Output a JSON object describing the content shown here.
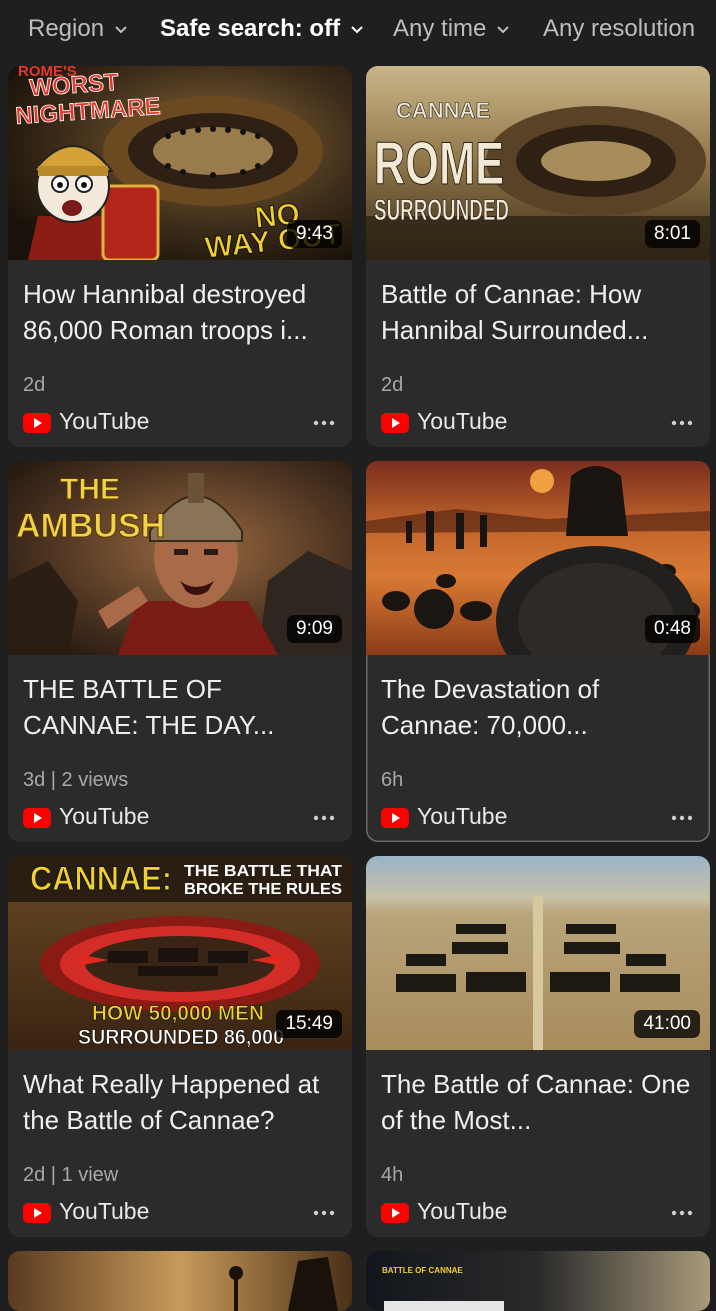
{
  "filters": [
    {
      "label": "Region",
      "active": false
    },
    {
      "label": "Safe search: off",
      "active": true
    },
    {
      "label": "Any time",
      "active": false
    },
    {
      "label": "Any resolution",
      "active": false
    }
  ],
  "results": [
    {
      "thumb_text": [
        "ROME'S",
        "WORST",
        "NIGHTMARE",
        "NO",
        "WAY OUT"
      ],
      "duration": "9:43",
      "title": "How Hannibal destroyed 86,000 Roman troops i...",
      "meta": "2d",
      "source": "YouTube"
    },
    {
      "thumb_text": [
        "CANNAE",
        "ROME",
        "SURROUNDED"
      ],
      "duration": "8:01",
      "title": "Battle of Cannae: How Hannibal Surrounded...",
      "meta": "2d",
      "source": "YouTube"
    },
    {
      "thumb_text": [
        "THE",
        "AMBUSH"
      ],
      "duration": "9:09",
      "title": "THE BATTLE OF CANNAE: THE DAY...",
      "meta": "3d | 2 views",
      "source": "YouTube"
    },
    {
      "thumb_text": [],
      "duration": "0:48",
      "title": "The Devastation of Cannae: 70,000...",
      "meta": "6h",
      "source": "YouTube"
    },
    {
      "thumb_text": [
        "CANNAE:",
        "THE BATTLE THAT",
        "BROKE THE RULES",
        "HOW 50,000 MEN",
        "SURROUNDED 86,000"
      ],
      "duration": "15:49",
      "title": "What Really Happened at the Battle of Cannae?",
      "meta": "2d | 1 view",
      "source": "YouTube"
    },
    {
      "thumb_text": [],
      "duration": "41:00",
      "title": "The Battle of Cannae: One of the Most...",
      "meta": "4h",
      "source": "YouTube"
    },
    {
      "thumb_text": [],
      "duration": "",
      "title": "",
      "meta": "",
      "source": ""
    },
    {
      "thumb_text": [
        "BATTLE OF CANNAE"
      ],
      "duration": "",
      "title": "",
      "meta": "",
      "source": ""
    }
  ],
  "colors": {
    "background": "#1f1f1f",
    "card": "#2b2b2b",
    "youtube_red": "#ff0000",
    "meta_text": "#a8a8a8"
  },
  "icons": [
    "chevron-down-icon",
    "youtube-logo-icon",
    "more-options-icon"
  ]
}
